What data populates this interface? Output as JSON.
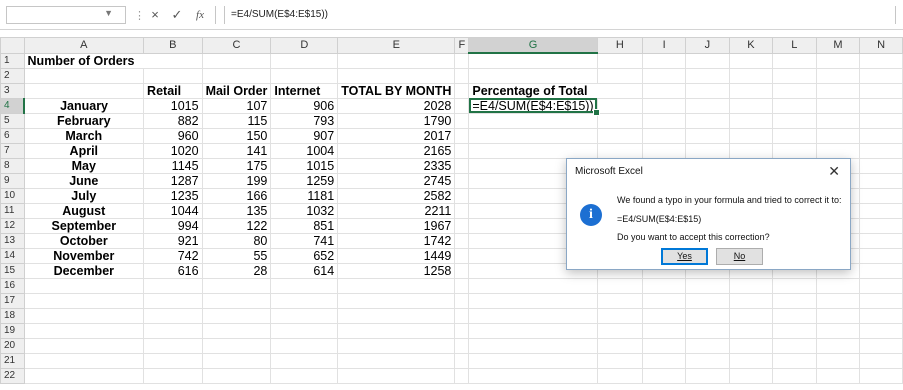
{
  "formula_bar": {
    "name_box": "",
    "cancel_glyph": "×",
    "enter_glyph": "✓",
    "fx_glyph": "fx",
    "formula": "=E4/SUM(E$4:E$15))"
  },
  "sheet": {
    "columns": [
      "A",
      "B",
      "C",
      "D",
      "E",
      "F",
      "G",
      "H",
      "I",
      "J",
      "K",
      "L",
      "M",
      "N"
    ],
    "title": "Number of Orders",
    "headers": {
      "retail": "Retail",
      "mail": "Mail Order",
      "internet": "Internet",
      "total": "TOTAL BY MONTH",
      "pct": "Percentage of Total"
    },
    "active_cell_text": "=E4/SUM(E$4:E$15))",
    "months": [
      {
        "month": "January",
        "retail": "1015",
        "mail": "107",
        "internet": "906",
        "total": "2028"
      },
      {
        "month": "February",
        "retail": "882",
        "mail": "115",
        "internet": "793",
        "total": "1790"
      },
      {
        "month": "March",
        "retail": "960",
        "mail": "150",
        "internet": "907",
        "total": "2017"
      },
      {
        "month": "April",
        "retail": "1020",
        "mail": "141",
        "internet": "1004",
        "total": "2165"
      },
      {
        "month": "May",
        "retail": "1145",
        "mail": "175",
        "internet": "1015",
        "total": "2335"
      },
      {
        "month": "June",
        "retail": "1287",
        "mail": "199",
        "internet": "1259",
        "total": "2745"
      },
      {
        "month": "July",
        "retail": "1235",
        "mail": "166",
        "internet": "1181",
        "total": "2582"
      },
      {
        "month": "August",
        "retail": "1044",
        "mail": "135",
        "internet": "1032",
        "total": "2211"
      },
      {
        "month": "September",
        "retail": "994",
        "mail": "122",
        "internet": "851",
        "total": "1967"
      },
      {
        "month": "October",
        "retail": "921",
        "mail": "80",
        "internet": "741",
        "total": "1742"
      },
      {
        "month": "November",
        "retail": "742",
        "mail": "55",
        "internet": "652",
        "total": "1449"
      },
      {
        "month": "December",
        "retail": "616",
        "mail": "28",
        "internet": "614",
        "total": "1258"
      }
    ],
    "row_numbers": [
      "1",
      "2",
      "3",
      "4",
      "5",
      "6",
      "7",
      "8",
      "9",
      "10",
      "11",
      "12",
      "13",
      "14",
      "15",
      "16",
      "17",
      "18",
      "19",
      "20",
      "21",
      "22"
    ]
  },
  "dialog": {
    "title": "Microsoft Excel",
    "close_glyph": "✕",
    "icon_glyph": "i",
    "message": "We found a typo in your formula and tried to correct it to:",
    "correction": "=E4/SUM(E$4:E$15)",
    "question": "Do you want to accept this correction?",
    "yes_label": "Yes",
    "no_label": "No"
  },
  "colors": {
    "excel_green": "#217346",
    "info_blue": "#1c6fd2"
  }
}
